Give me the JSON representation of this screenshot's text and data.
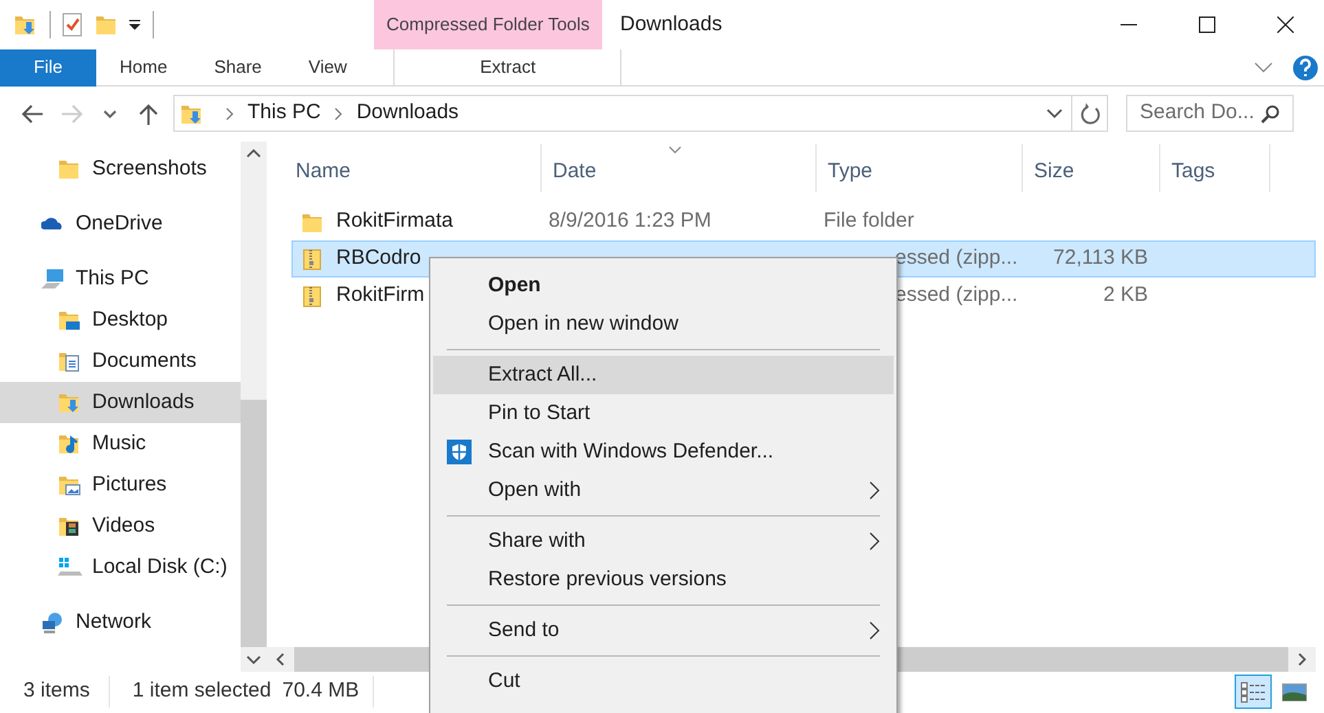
{
  "window": {
    "title": "Downloads"
  },
  "context_tab_group": {
    "label": "Compressed Folder Tools"
  },
  "ribbon_tabs": [
    {
      "label": "File",
      "kind": "file"
    },
    {
      "label": "Home",
      "kind": "normal"
    },
    {
      "label": "Share",
      "kind": "normal"
    },
    {
      "label": "View",
      "kind": "normal"
    },
    {
      "label": "Extract",
      "kind": "contextual"
    }
  ],
  "address_bar": {
    "path": [
      "This PC",
      "Downloads"
    ]
  },
  "search": {
    "placeholder": "Search Do..."
  },
  "sidebar": {
    "continued_items": [
      {
        "label": "Screenshots",
        "kind": "folder",
        "selected": false
      }
    ],
    "items": [
      {
        "label": "OneDrive",
        "kind": "cloud",
        "selected": false
      },
      {
        "label": "This PC",
        "kind": "pc",
        "selected": false,
        "children": [
          {
            "label": "Desktop",
            "kind": "desktop",
            "selected": false
          },
          {
            "label": "Documents",
            "kind": "documents",
            "selected": false
          },
          {
            "label": "Downloads",
            "kind": "downloads",
            "selected": true
          },
          {
            "label": "Music",
            "kind": "music",
            "selected": false
          },
          {
            "label": "Pictures",
            "kind": "pictures",
            "selected": false
          },
          {
            "label": "Videos",
            "kind": "videos",
            "selected": false
          },
          {
            "label": "Local Disk (C:)",
            "kind": "drive",
            "selected": false
          }
        ]
      },
      {
        "label": "Network",
        "kind": "network",
        "selected": false
      }
    ]
  },
  "table": {
    "columns": [
      {
        "label": "Name",
        "sorted": false
      },
      {
        "label": "Date",
        "sorted": true
      },
      {
        "label": "Type",
        "sorted": false
      },
      {
        "label": "Size",
        "sorted": false
      },
      {
        "label": "Tags",
        "sorted": false
      }
    ],
    "rows": [
      {
        "kind": "folder",
        "name": "RokitFirmata",
        "date": "8/9/2016 1:23 PM",
        "type": "File folder",
        "selected": false
      },
      {
        "kind": "zip",
        "name": "RBCodro",
        "type": "essed (zipp...",
        "size": "72,113 KB",
        "selected": true
      },
      {
        "kind": "zip",
        "name": "RokitFirm",
        "type": "essed (zipp...",
        "size": "2 KB",
        "selected": false
      }
    ]
  },
  "context_menu": {
    "items": [
      {
        "kind": "item",
        "label": "Open",
        "default": true
      },
      {
        "kind": "item",
        "label": "Open in new window"
      },
      {
        "kind": "separator"
      },
      {
        "kind": "item",
        "label": "Extract All...",
        "highlighted": true
      },
      {
        "kind": "item",
        "label": "Pin to Start"
      },
      {
        "kind": "item",
        "label": "Scan with Windows Defender...",
        "has_icon": true
      },
      {
        "kind": "item",
        "label": "Open with",
        "submenu": true
      },
      {
        "kind": "separator"
      },
      {
        "kind": "item",
        "label": "Share with",
        "submenu": true
      },
      {
        "kind": "item",
        "label": "Restore previous versions"
      },
      {
        "kind": "separator"
      },
      {
        "kind": "item",
        "label": "Send to",
        "submenu": true
      },
      {
        "kind": "separator"
      },
      {
        "kind": "item",
        "label": "Cut"
      }
    ]
  },
  "status_bar": {
    "item_count": "3 items",
    "selection": "1 item selected",
    "size": "70.4 MB"
  },
  "view_buttons": [
    {
      "kind": "details",
      "selected": true
    },
    {
      "kind": "large_icons",
      "selected": false
    }
  ]
}
